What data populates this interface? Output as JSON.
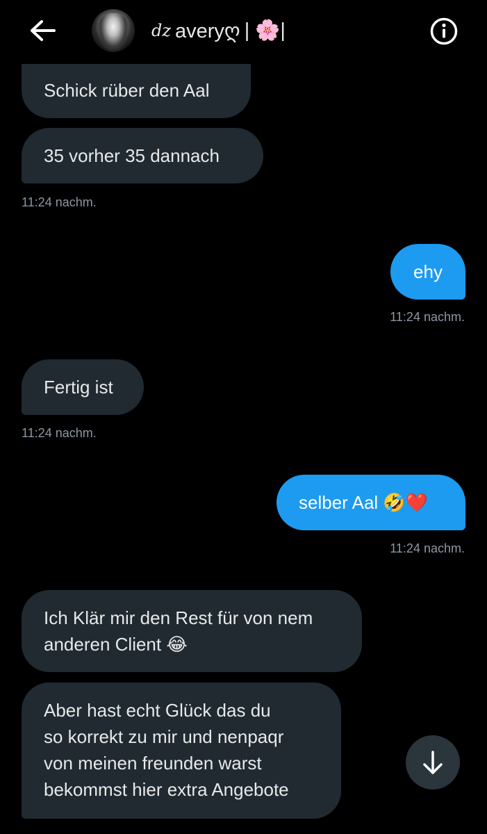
{
  "header": {
    "title_prefix": "dz",
    "title_name": "averyღ",
    "title_suffix": "| 🌸|",
    "back_icon": "arrow-left-icon",
    "info_icon": "info-circle-icon"
  },
  "messages": [
    {
      "side": "received",
      "text": "Schick rüber den Aal"
    },
    {
      "side": "received",
      "text": "35 vorher 35 dannach",
      "time": "11:24 nachm."
    },
    {
      "side": "sent",
      "text": "ehy",
      "time": "11:24 nachm."
    },
    {
      "side": "received",
      "text": "Fertig ist",
      "time": "11:24 nachm."
    },
    {
      "side": "sent",
      "text": "selber Aal",
      "emoji": "🤣❤️",
      "time": "11:24 nachm."
    },
    {
      "side": "received",
      "lines": [
        "Ich Klär mir den Rest für von nem",
        "anderen Client"
      ],
      "emoji": "😂"
    },
    {
      "side": "received",
      "lines": [
        "Aber hast echt Glück das du",
        "so korrekt zu mir und nenpaqr",
        "von meinen freunden warst",
        "bekommst hier extra Angebote"
      ]
    }
  ],
  "scroll_button": {
    "icon": "arrow-down-icon"
  },
  "colors": {
    "background": "#000000",
    "received_bubble": "#202a30",
    "sent_bubble": "#1d9bf0",
    "timestamp": "#8b98a5"
  }
}
